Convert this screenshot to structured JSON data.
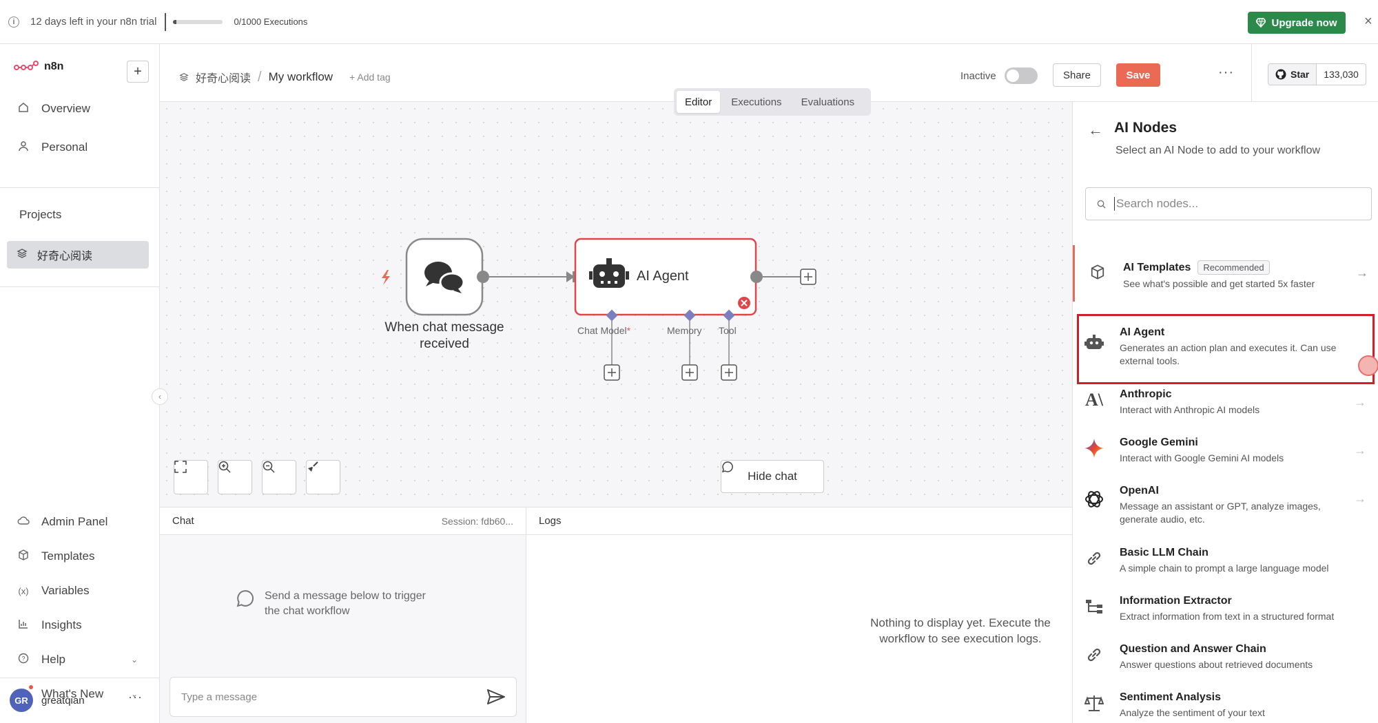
{
  "banner": {
    "trial_text": "12 days left in your n8n trial",
    "executions": "0/1000 Executions",
    "executions_fraction": 0.0,
    "upgrade_label": "Upgrade now",
    "close": "×"
  },
  "sidebar": {
    "brand": "n8n",
    "add": "+",
    "top_items": [
      {
        "label": "Overview",
        "icon": "home-icon"
      },
      {
        "label": "Personal",
        "icon": "user-icon"
      }
    ],
    "projects_label": "Projects",
    "project": "好奇心阅读",
    "bottom_items": [
      {
        "label": "Admin Panel",
        "icon": "cloud-icon"
      },
      {
        "label": "Templates",
        "icon": "box-icon"
      },
      {
        "label": "Variables",
        "icon": "variables-icon"
      },
      {
        "label": "Insights",
        "icon": "chart-icon"
      },
      {
        "label": "Help",
        "icon": "help-icon"
      },
      {
        "label": "What's New",
        "icon": "bell-icon"
      }
    ],
    "user": {
      "initials": "GR",
      "name": "greatqian"
    }
  },
  "header": {
    "project": "好奇心阅读",
    "workflow": "My workflow",
    "add_tag": "+ Add tag",
    "status": "Inactive",
    "share": "Share",
    "save": "Save",
    "more": "···",
    "github_star": "Star",
    "github_count": "133,030"
  },
  "tabs": [
    "Editor",
    "Executions",
    "Evaluations"
  ],
  "canvas": {
    "trigger_label_1": "When chat message",
    "trigger_label_2": "received",
    "agent_title": "AI Agent",
    "chat_model": "Chat Model",
    "required_mark": "*",
    "memory": "Memory",
    "tool": "Tool",
    "hide_chat": "Hide chat"
  },
  "chat": {
    "title": "Chat",
    "session": "Session: fdb60...",
    "empty": "Send a message below to trigger the chat workflow",
    "input_placeholder": "Type a message"
  },
  "logs": {
    "title": "Logs",
    "empty": "Nothing to display yet. Execute the workflow to see execution logs."
  },
  "ai_panel": {
    "title": "AI Nodes",
    "subtitle": "Select an AI Node to add to your workflow",
    "search_placeholder": "Search nodes...",
    "items": [
      {
        "title": "AI Templates",
        "badge": "Recommended",
        "desc": "See what's possible and get started 5x faster"
      },
      {
        "title": "AI Agent",
        "desc": "Generates an action plan and executes it. Can use external tools."
      },
      {
        "title": "Anthropic",
        "desc": "Interact with Anthropic AI models"
      },
      {
        "title": "Google Gemini",
        "desc": "Interact with Google Gemini AI models"
      },
      {
        "title": "OpenAI",
        "desc": "Message an assistant or GPT, analyze images, generate audio, etc."
      },
      {
        "title": "Basic LLM Chain",
        "desc": "A simple chain to prompt a large language model"
      },
      {
        "title": "Information Extractor",
        "desc": "Extract information from text in a structured format"
      },
      {
        "title": "Question and Answer Chain",
        "desc": "Answer questions about retrieved documents"
      },
      {
        "title": "Sentiment Analysis",
        "desc": "Analyze the sentiment of your text"
      }
    ]
  },
  "colors": {
    "accent": "#ea6a55",
    "upgrade": "#2b8a4a",
    "highlight": "#d11f27",
    "node_handle": "#7b7fbd"
  }
}
